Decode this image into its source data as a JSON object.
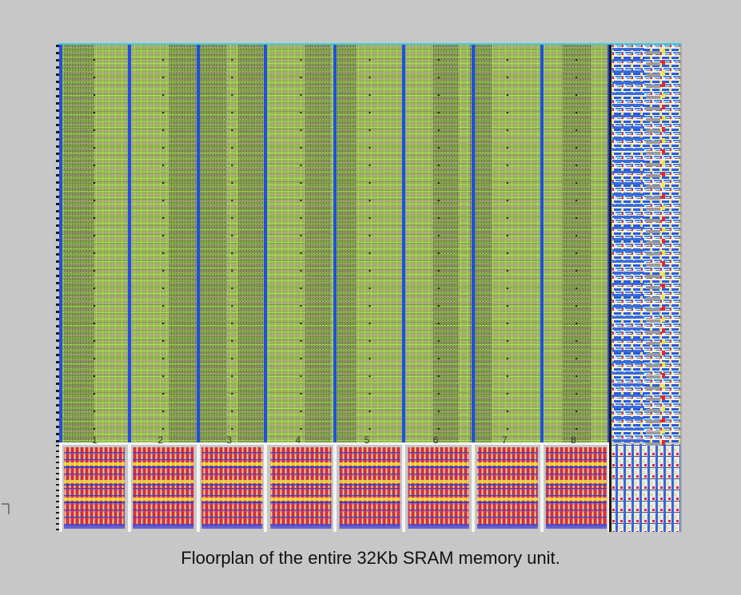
{
  "caption": "Floorplan of the entire 32Kb SRAM memory unit.",
  "bank_labels": [
    "1",
    "2",
    "3",
    "4",
    "5",
    "6",
    "7",
    "8"
  ],
  "colors": {
    "background": "#c7c7c7",
    "array_fill": "#8fb64a",
    "grid_green": "#a6e24a",
    "grid_pink": "#e08ad8",
    "bitline_dark": "#2a2a2a",
    "bank_divider_blue": "#1f4fe0",
    "periphery_pink": "#e0708a",
    "periphery_red": "#e8262a",
    "periphery_yellow": "#f3e33a",
    "periphery_blue": "#2444d8",
    "decoder_blue": "#3b6bd8",
    "cyan_rail": "#35d2e0"
  }
}
